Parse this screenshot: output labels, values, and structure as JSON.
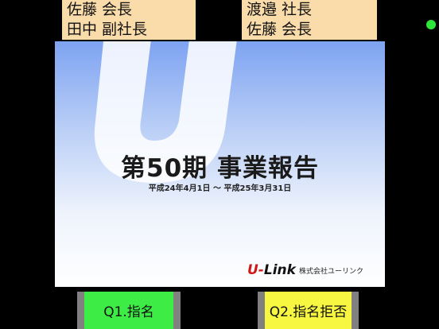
{
  "speakers_left": [
    "佐藤 会長",
    "田中 副社長"
  ],
  "speakers_right": [
    "渡邉 社長",
    "佐藤 会長"
  ],
  "status": {
    "color": "#2ee63a"
  },
  "slide": {
    "title": "第50期 事業報告",
    "subtitle": "平成24年4月1日 ～ 平成25年3月31日",
    "logo_prefix": "U-",
    "logo_suffix": "Link",
    "company": "株式会社ユーリンク"
  },
  "buttons": {
    "q1_label": "Q1.指名",
    "q2_label": "Q2.指名拒否"
  }
}
